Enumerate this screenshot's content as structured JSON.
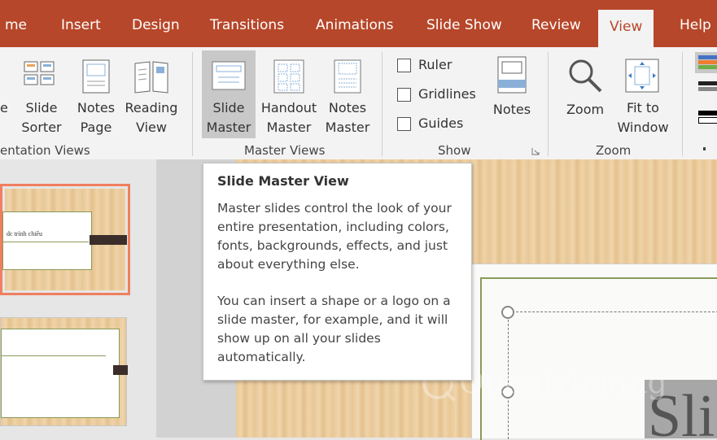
{
  "tabs": [
    {
      "label": "me"
    },
    {
      "label": "Insert"
    },
    {
      "label": "Design"
    },
    {
      "label": "Transitions"
    },
    {
      "label": "Animations"
    },
    {
      "label": "Slide Show"
    },
    {
      "label": "Review"
    },
    {
      "label": "View"
    },
    {
      "label": "Help"
    }
  ],
  "ribbon": {
    "presentation_views": {
      "group_label": "entation Views",
      "normal_tail": "e",
      "slide_sorter": [
        "Slide",
        "Sorter"
      ],
      "notes_page": [
        "Notes",
        "Page"
      ],
      "reading_view": [
        "Reading",
        "View"
      ]
    },
    "master_views": {
      "group_label": "Master Views",
      "slide_master": [
        "Slide",
        "Master"
      ],
      "handout_master": [
        "Handout",
        "Master"
      ],
      "notes_master": [
        "Notes",
        "Master"
      ]
    },
    "show": {
      "group_label": "Show",
      "ruler": "Ruler",
      "gridlines": "Gridlines",
      "guides": "Guides",
      "notes": "Notes"
    },
    "zoom": {
      "group_label": "Zoom",
      "zoom": "Zoom",
      "fit_to_window": [
        "Fit to",
        "Window"
      ]
    }
  },
  "thumbnails": {
    "slide1_title": "dc trình chiếu"
  },
  "tooltip": {
    "title": "Slide Master View",
    "para1": "Master slides control the look of your entire presentation, including colors, fonts, backgrounds, effects, and just about everything else.",
    "para2": "You can insert a shape or a logo on a slide master, for example, and it will show up on all your slides automatically."
  },
  "slide": {
    "title_fragment": "Sli"
  },
  "watermark": "Quantrimang",
  "colors": {
    "accent": "#b7472a",
    "selected_button": "#c8c8c8",
    "thumb_selected_border": "#f07f5f"
  }
}
